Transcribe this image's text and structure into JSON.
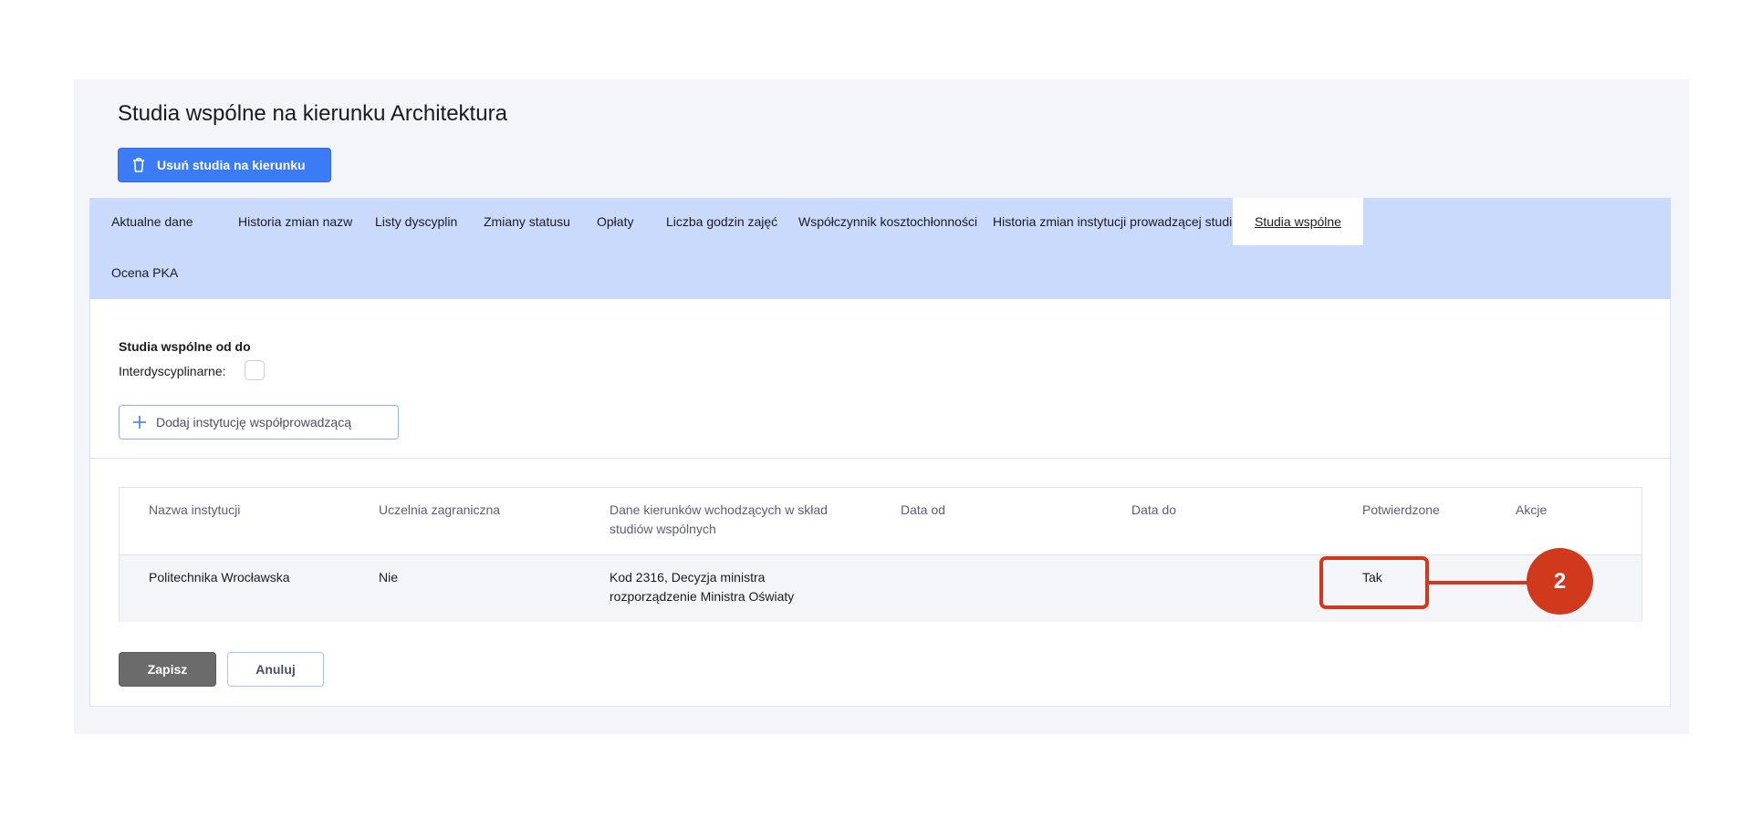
{
  "page": {
    "title": "Studia wspólne na kierunku Architektura",
    "delete_button_label": "Usuń studia na kierunku"
  },
  "tabs": [
    {
      "label": "Aktualne dane",
      "active": false
    },
    {
      "label": "Historia zmian nazw",
      "active": false
    },
    {
      "label": "Listy dyscyplin",
      "active": false
    },
    {
      "label": "Zmiany statusu",
      "active": false
    },
    {
      "label": "Opłaty",
      "active": false
    },
    {
      "label": "Liczba godzin zajęć",
      "active": false
    },
    {
      "label": "Współczynnik kosztochłonności",
      "active": false
    },
    {
      "label": "Historia zmian instytucji prowadzącej studia",
      "active": false
    },
    {
      "label": "Studia wspólne",
      "active": true
    },
    {
      "label": "Ocena PKA",
      "active": false
    }
  ],
  "section": {
    "title": "Studia wspólne od do",
    "interdisciplinary_label": "Interdyscyplinarne:",
    "interdisciplinary_checked": false,
    "add_institution_label": "Dodaj instytucję współprowadzącą"
  },
  "table": {
    "headers": {
      "name": "Nazwa instytucji",
      "foreign": "Uczelnia zagraniczna",
      "programs": "Dane kierunków wchodzących w skład studiów wspólnych",
      "date_from": "Data od",
      "date_to": "Data do",
      "confirmed": "Potwierdzone",
      "actions": "Akcje"
    },
    "rows": [
      {
        "name": "Politechnika Wrocławska",
        "foreign": "Nie",
        "programs": "Kod 2316, Decyzja ministra rozporządzenie Ministra Oświaty",
        "date_from": "",
        "date_to": "",
        "confirmed": "Tak",
        "actions": ""
      }
    ]
  },
  "footer": {
    "save_label": "Zapisz",
    "cancel_label": "Anuluj"
  },
  "callout": {
    "number": "2",
    "color": "#d0391c"
  },
  "colors": {
    "primary": "#3b7cf6",
    "tabs_background": "#c9dafd",
    "panel_background": "#f4f5f9"
  }
}
